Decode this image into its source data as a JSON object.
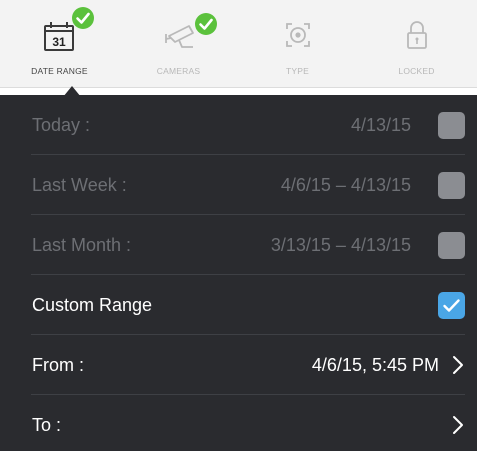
{
  "tabs": [
    {
      "label": "DATE RANGE",
      "icon": "calendar-icon",
      "calendar_day": "31",
      "checked": true,
      "active": true
    },
    {
      "label": "CAMERAS",
      "icon": "security-camera-icon",
      "checked": true,
      "active": false
    },
    {
      "label": "TYPE",
      "icon": "motion-target-icon",
      "checked": false,
      "active": false
    },
    {
      "label": "LOCKED",
      "icon": "lock-icon",
      "checked": false,
      "active": false
    }
  ],
  "rows": {
    "today": {
      "label": "Today :",
      "value": "4/13/15",
      "checked": false
    },
    "last_week": {
      "label": "Last Week :",
      "value": "4/6/15 – 4/13/15",
      "checked": false
    },
    "last_month": {
      "label": "Last Month :",
      "value": "3/13/15 – 4/13/15",
      "checked": false
    },
    "custom_range": {
      "label": "Custom Range",
      "checked": true
    },
    "from": {
      "label": "From :",
      "value": "4/6/15, 5:45 PM"
    },
    "to": {
      "label": "To :",
      "value": ""
    }
  },
  "colors": {
    "list_background": "#2a2b2f",
    "tabbar_background": "#f3f3f3",
    "check_badge_green": "#5bc13c",
    "checkbox_checked_blue": "#4aa6e6",
    "checkbox_unchecked_gray": "#8b8d92",
    "dimmed_text": "#6d6f74"
  }
}
